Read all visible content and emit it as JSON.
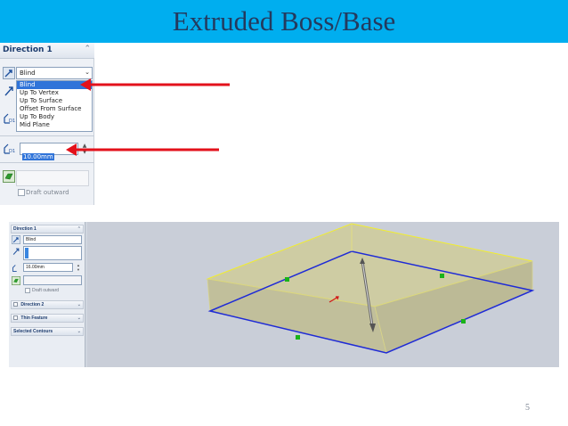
{
  "slide": {
    "title": "Extruded Boss/Base",
    "page_number": "5",
    "accent_color": "#00aeef",
    "arrow_color": "#e3111b"
  },
  "panel": {
    "header": "Direction 1",
    "end_condition": "Blind",
    "end_condition_options": [
      "Blind",
      "Up To Vertex",
      "Up To Surface",
      "Offset From Surface",
      "Up To Body",
      "Mid Plane"
    ],
    "selected_option_index": 0,
    "depth_value": "10.00mm",
    "draft_label": "Draft outward"
  },
  "screenshot": {
    "direction1_header": "Direction 1",
    "end_condition": "Blind",
    "depth_value": "16.00mm",
    "draft_label": "Draft outward",
    "direction2_header": "Direction 2",
    "thin_feature_header": "Thin Feature",
    "selected_contours_header": "Selected Contours",
    "model_fill_color": "#c9c596",
    "sketch_line_color": "#1f2bd6",
    "edge_highlight_color": "#f2ee2c"
  },
  "icons": {
    "direction_flip": "flip-direction-icon",
    "direction_arrow": "direction-arrow-icon",
    "depth": "depth-icon",
    "merge": "merge-result-icon",
    "collapse": "chevron-up-icon"
  }
}
